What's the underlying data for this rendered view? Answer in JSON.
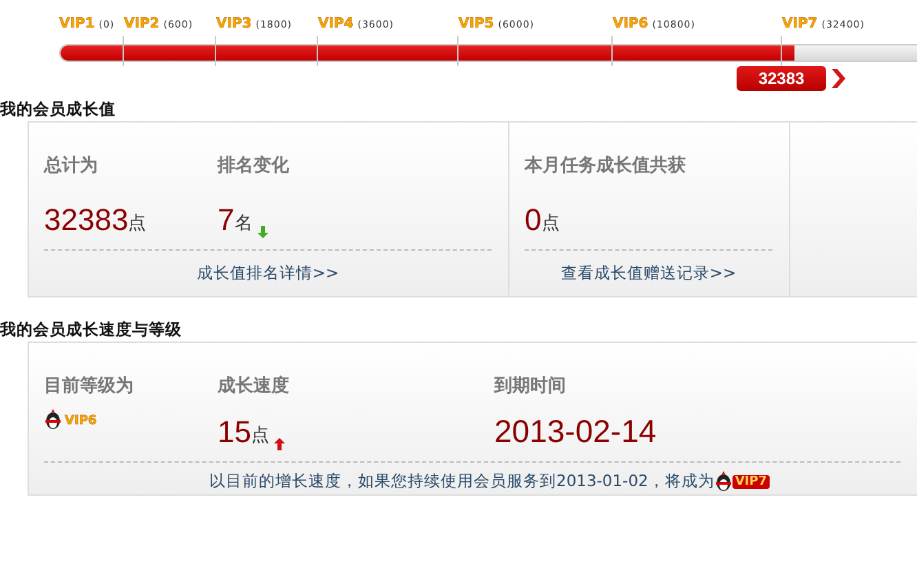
{
  "progress": {
    "level": 0.845,
    "value": "32383",
    "markers": [
      {
        "label": "VIP1",
        "points": "(0)"
      },
      {
        "label": "VIP2",
        "points": "(600)"
      },
      {
        "label": "VIP3",
        "points": "(1800)"
      },
      {
        "label": "VIP4",
        "points": "(3600)"
      },
      {
        "label": "VIP5",
        "points": "(6000)"
      },
      {
        "label": "VIP6",
        "points": "(10800)"
      },
      {
        "label": "VIP7",
        "points": "(32400)"
      }
    ]
  },
  "growth_value": {
    "title": "我的会员成长值",
    "total": {
      "label": "总计为",
      "value": "32383",
      "unit": "点"
    },
    "rank_change": {
      "label": "排名变化",
      "value": "7",
      "unit": "名",
      "rising": false
    },
    "rank_link": "成长值排名详情>>",
    "monthly": {
      "label": "本月任务成长值共获",
      "value": "0",
      "unit": "点"
    },
    "monthly_link": "查看成长值赠送记录>>"
  },
  "speed_level": {
    "title": "我的会员成长速度与等级",
    "level": {
      "label": "目前等级为",
      "badge": "VIP6"
    },
    "speed": {
      "label": "成长速度",
      "value": "15",
      "unit": "点",
      "rising": true
    },
    "expiry": {
      "label": "到期时间",
      "value": "2013-02-14"
    },
    "note": "以目前的增长速度，如果您持续使用会员服务到2013-01-02，将成为",
    "note_badge": "VIP7"
  }
}
